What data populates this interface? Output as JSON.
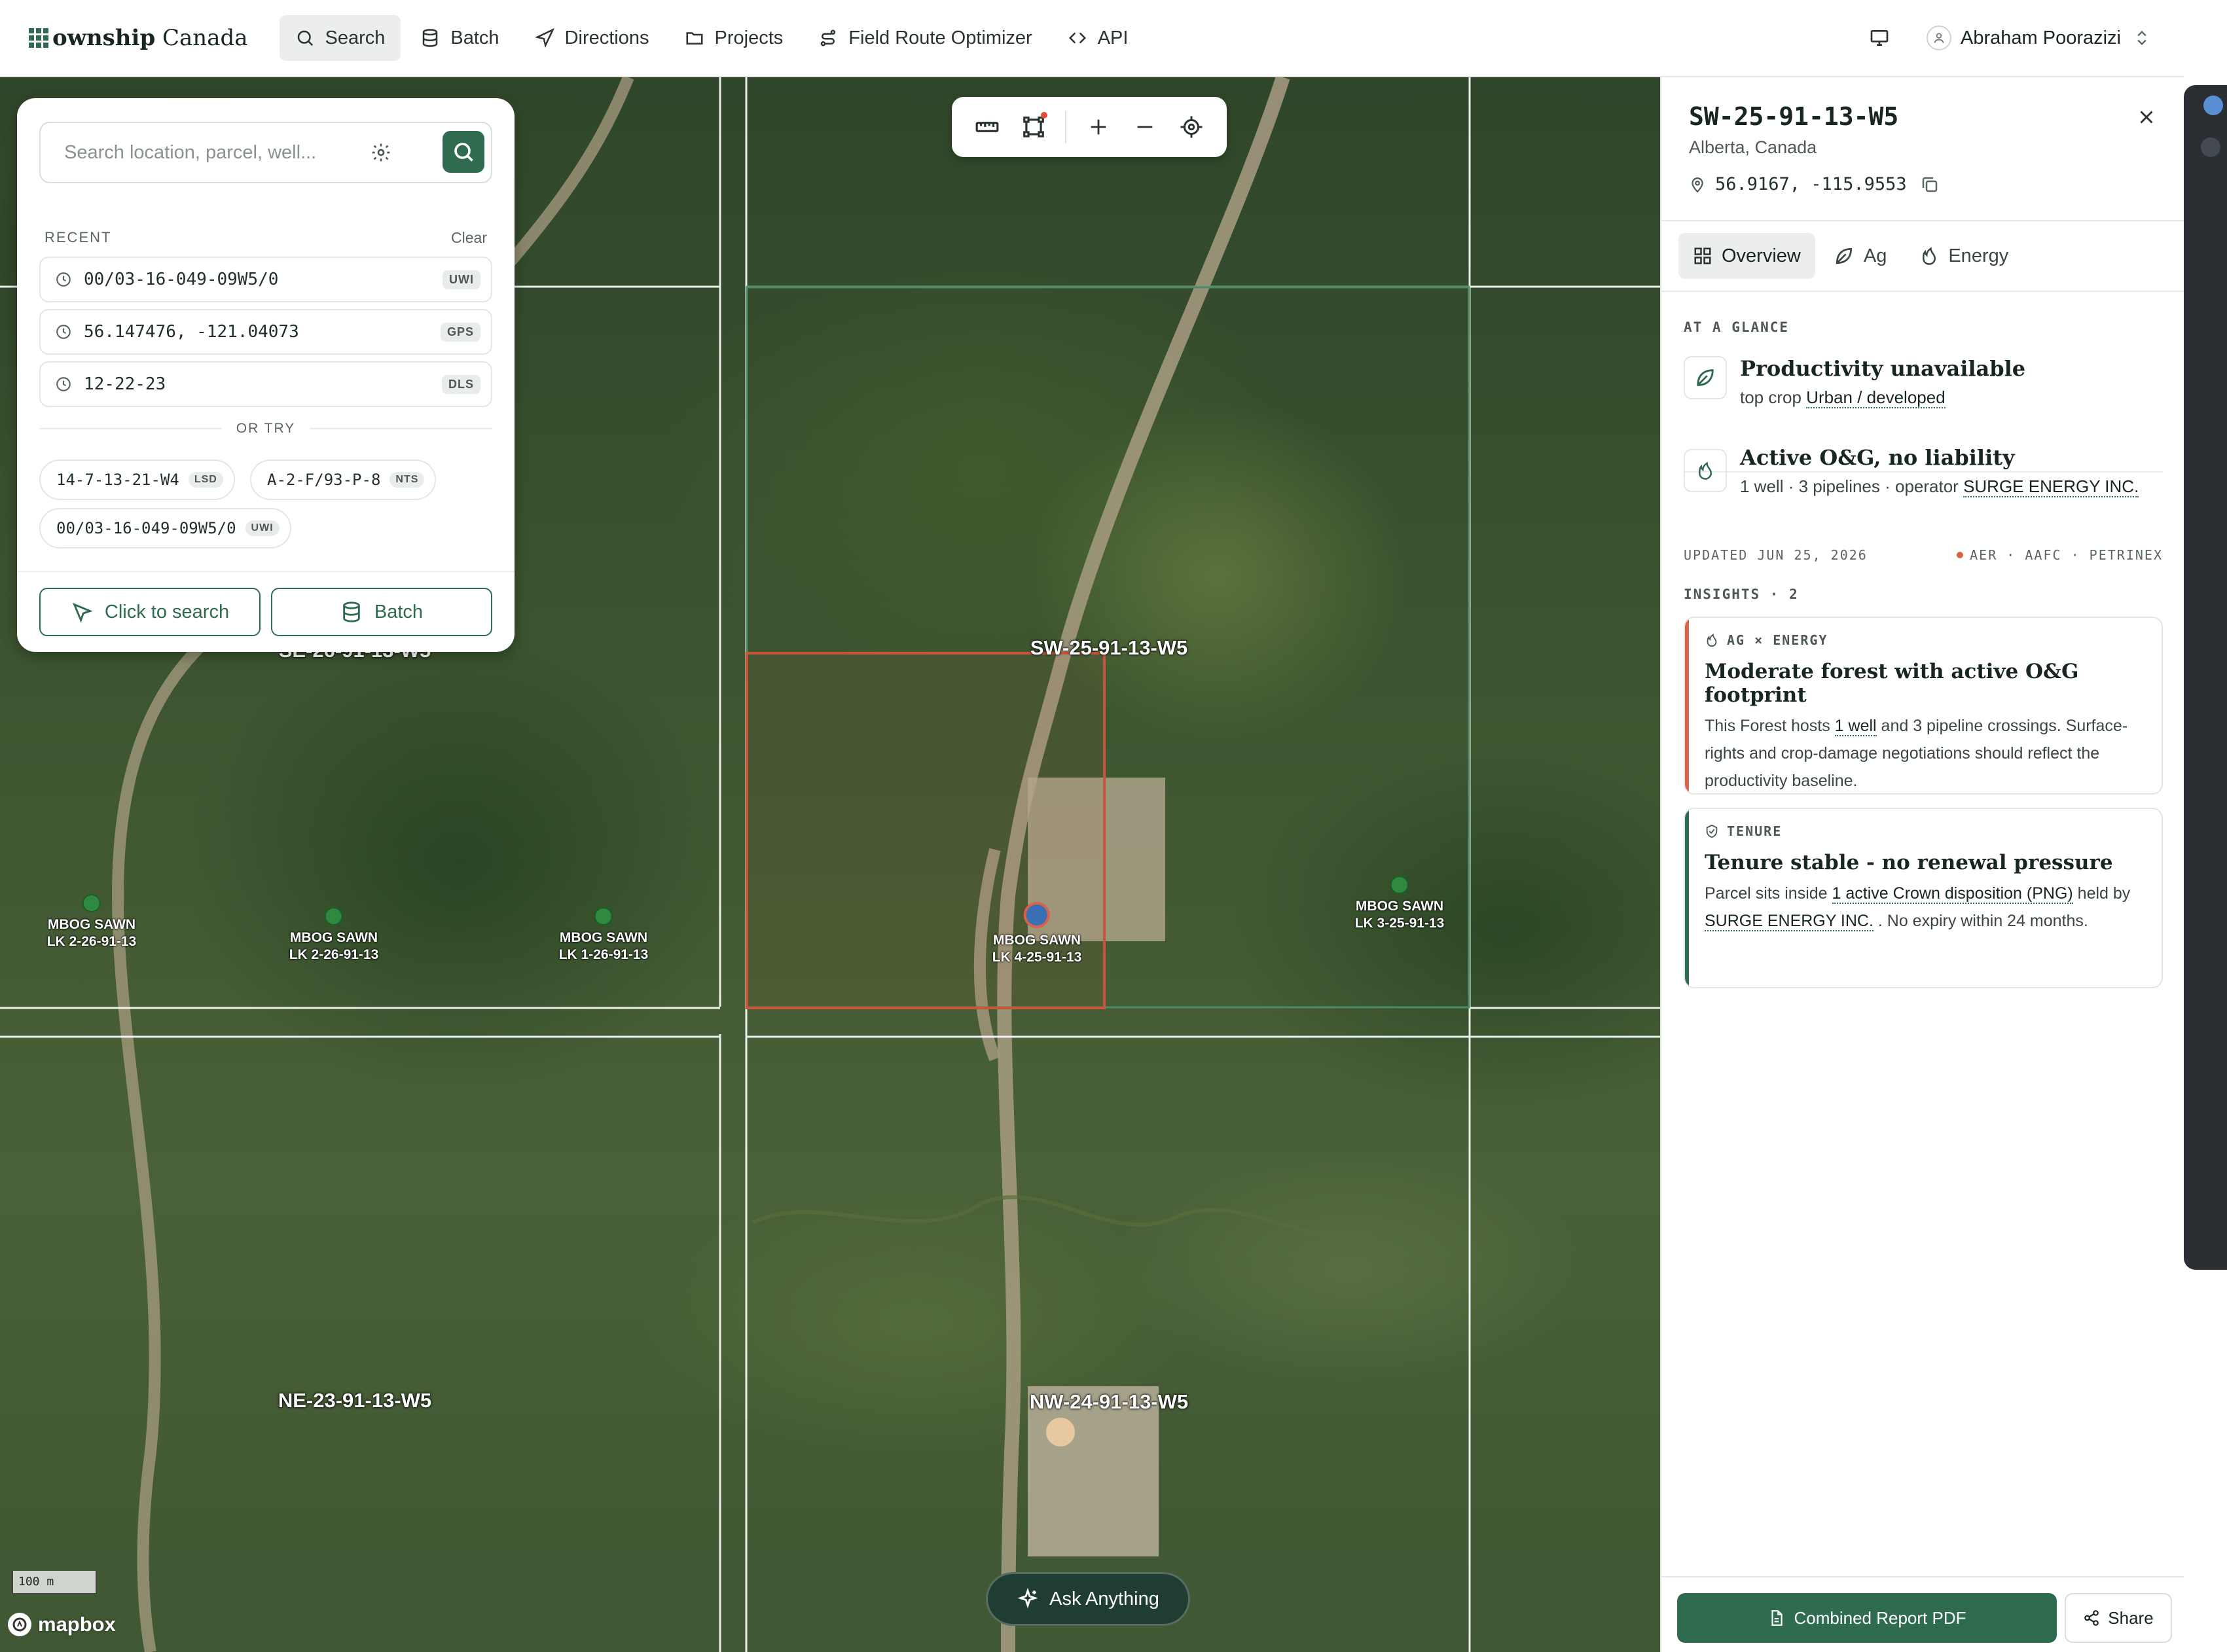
{
  "app": {
    "logo_bold": "ownship",
    "logo_rest": " Canada",
    "nav": [
      {
        "label": "Search",
        "icon": "search-icon",
        "active": true
      },
      {
        "label": "Batch",
        "icon": "database-icon"
      },
      {
        "label": "Directions",
        "icon": "navigation-arrow-icon"
      },
      {
        "label": "Projects",
        "icon": "folder-icon"
      },
      {
        "label": "Field Route Optimizer",
        "icon": "route-icon"
      },
      {
        "label": "API",
        "icon": "code-icon"
      }
    ],
    "user_name": "Abraham Poorazizi",
    "accent": "#2f6b4f"
  },
  "search": {
    "placeholder": "Search location, parcel, well...",
    "recent_label": "RECENT",
    "clear_label": "Clear",
    "recent": [
      {
        "value": "00/03-16-049-09W5/0",
        "badge": "UWI"
      },
      {
        "value": "56.147476, -121.04073",
        "badge": "GPS"
      },
      {
        "value": "12-22-23",
        "badge": "DLS"
      }
    ],
    "or_try_label": "OR TRY",
    "suggestions": [
      {
        "value": "14-7-13-21-W4",
        "badge": "LSD"
      },
      {
        "value": "A-2-F/93-P-8",
        "badge": "NTS"
      },
      {
        "value": "00/03-16-049-09W5/0",
        "badge": "UWI"
      }
    ],
    "click_to_search_label": "Click to search",
    "batch_label": "Batch"
  },
  "map": {
    "parcels": [
      {
        "label": "SW-25-91-13-W5"
      },
      {
        "label": "NE-23-91-13-W5"
      },
      {
        "label": "NW-24-91-13-W5"
      },
      {
        "label": "SE-26-91-13-W5"
      }
    ],
    "wells": [
      {
        "label": "MBOG SAWN\nLK 2-26-91-13"
      },
      {
        "label": "MBOG SAWN\nLK 2-26-91-13"
      },
      {
        "label": "MBOG SAWN\nLK 1-26-91-13"
      },
      {
        "label": "MBOG SAWN\nLK 4-25-91-13"
      },
      {
        "label": "MBOG SAWN\nLK 3-25-91-13"
      }
    ],
    "scale_label": "100 m",
    "attribution": "mapbox",
    "ask_label": "Ask Anything"
  },
  "panel": {
    "title": "SW-25-91-13-W5",
    "subtitle": "Alberta, Canada",
    "coords": "56.9167, -115.9553",
    "tabs": [
      {
        "label": "Overview",
        "icon": "grid-icon",
        "active": true
      },
      {
        "label": "Ag",
        "icon": "leaf-icon"
      },
      {
        "label": "Energy",
        "icon": "flame-icon"
      }
    ],
    "glance_label": "AT A GLANCE",
    "glance": [
      {
        "title": "Productivity unavailable",
        "sub_pre": "top crop ",
        "sub_link": "Urban / developed",
        "icon": "leaf-icon"
      },
      {
        "title": "Active O&G, no liability",
        "sub_pre": "1 well · 3 pipelines · operator ",
        "sub_link": "SURGE ENERGY INC.",
        "icon": "flame-icon"
      }
    ],
    "updated": "UPDATED JUN 25, 2026",
    "sources": "AER · AAFC · PETRINEX",
    "insights_label": "INSIGHTS · 2",
    "insights": [
      {
        "tag": "AG × ENERGY",
        "title": "Moderate forest with active O&G footprint",
        "b1": "This Forest hosts ",
        "link1": "1 well",
        "b2": "   and 3 pipeline crossings. Surface-rights and crop-damage negotiations should reflect the productivity baseline.",
        "color": "#d9634a"
      },
      {
        "tag": "TENURE",
        "title": "Tenure stable - no renewal pressure",
        "b1": "Parcel sits inside ",
        "link1": "1 active Crown disposition (PNG)",
        "b2": " held by ",
        "link2": "SURGE ENERGY INC.",
        "b3": "   . No expiry within 24 months.",
        "color": "#2f6b4f"
      }
    ],
    "pdf_label": "Combined Report PDF",
    "share_label": "Share"
  }
}
